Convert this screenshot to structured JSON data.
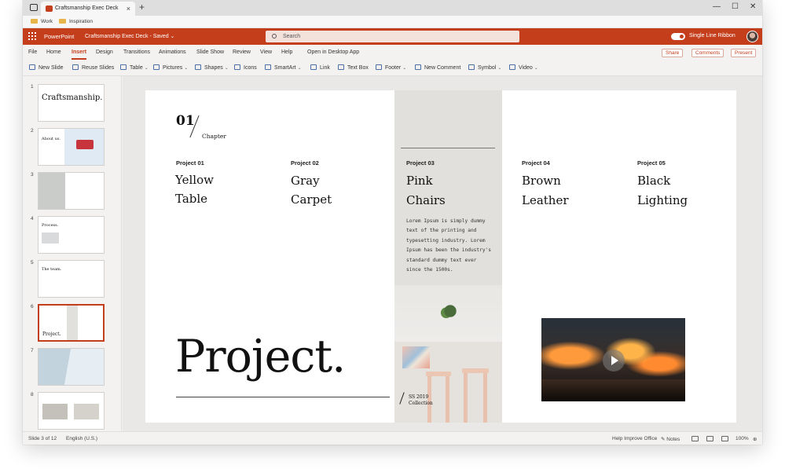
{
  "browser": {
    "tab_title": "Craftsmanship Exec Deck",
    "tab_close": "×",
    "new_tab": "+",
    "window_controls": [
      "—",
      "☐",
      "✕"
    ],
    "bookmarks": [
      "Work",
      "Inspiration"
    ]
  },
  "appbar": {
    "app_name": "PowerPoint",
    "doc_title": "Craftsmanship Exec Deck - Saved ⌄",
    "search_placeholder": "Search",
    "toggle_label": "Single Line Ribbon"
  },
  "menu": {
    "items": [
      "File",
      "Home",
      "Insert",
      "Design",
      "Transitions",
      "Animations",
      "Slide Show",
      "Review",
      "View",
      "Help",
      "Open in Desktop App"
    ],
    "active": "Insert",
    "actions": [
      "Share",
      "Comments",
      "Present"
    ]
  },
  "toolbar": {
    "items": [
      {
        "label": "New Slide",
        "chev": ""
      },
      {
        "label": "Reuse Slides",
        "chev": ""
      },
      {
        "label": "Table",
        "chev": "⌄"
      },
      {
        "label": "Pictures",
        "chev": "⌄"
      },
      {
        "label": "Shapes",
        "chev": "⌄"
      },
      {
        "label": "Icons",
        "chev": ""
      },
      {
        "label": "SmartArt",
        "chev": "⌄"
      },
      {
        "label": "Link",
        "chev": ""
      },
      {
        "label": "Text Box",
        "chev": ""
      },
      {
        "label": "Footer",
        "chev": "⌄"
      },
      {
        "label": "New Comment",
        "chev": ""
      },
      {
        "label": "Symbol",
        "chev": "⌄"
      },
      {
        "label": "Video",
        "chev": "⌄"
      }
    ]
  },
  "thumbnails": {
    "numbers": [
      "1",
      "2",
      "3",
      "4",
      "5",
      "6",
      "7",
      "8"
    ],
    "titles": [
      "Craftsmanship.",
      "About us.",
      "",
      "Process.",
      "The team.",
      "Project.",
      "",
      ""
    ],
    "selected_index": 6
  },
  "slide": {
    "chapter_number": "01",
    "chapter_label": "Chapter",
    "projects": [
      {
        "label": "Project 01",
        "line1": "Yellow",
        "line2": "Table"
      },
      {
        "label": "Project 02",
        "line1": "Gray",
        "line2": "Carpet"
      },
      {
        "label": "Project 03",
        "line1": "Pink",
        "line2": "Chairs"
      },
      {
        "label": "Project 04",
        "line1": "Brown",
        "line2": "Leather"
      },
      {
        "label": "Project 05",
        "line1": "Black",
        "line2": "Lighting"
      }
    ],
    "lorem": "Lorem Ipsum is simply dummy text of the printing and typesetting industry. Lorem Ipsum has been the industry's standard dummy text ever since the 1500s.",
    "big_title": "Project.",
    "caption_line1": "SS 2019",
    "caption_line2": "Collection"
  },
  "status": {
    "slide_info": "Slide 3 of 12",
    "language": "English (U.S.)",
    "help": "Help Improve Office",
    "notes": "Notes",
    "zoom": "100%"
  },
  "colors": {
    "accent": "#c43e1c",
    "grey_column": "#e2e0dc"
  }
}
